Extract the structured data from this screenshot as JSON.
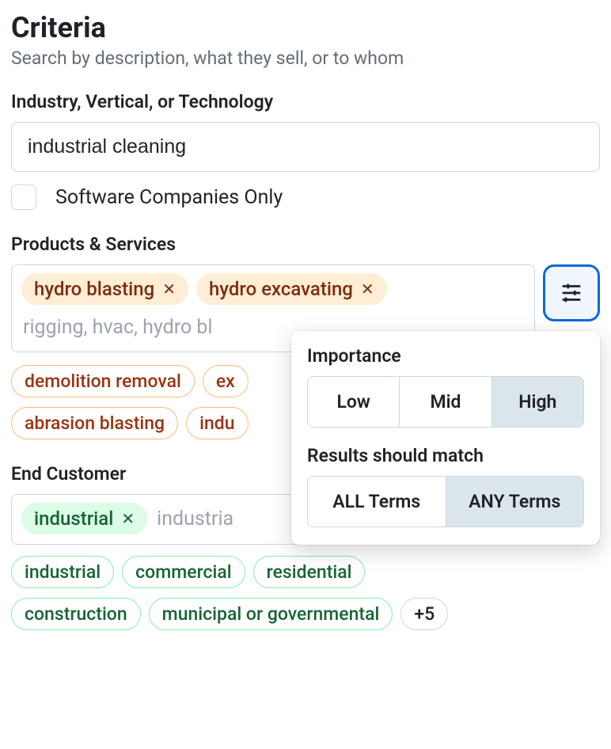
{
  "header": {
    "title": "Criteria",
    "subtitle": "Search by description, what they sell, or to whom"
  },
  "industry": {
    "label": "Industry, Vertical, or Technology",
    "value": "industrial cleaning",
    "checkbox_label": "Software Companies Only"
  },
  "products": {
    "label": "Products & Services",
    "tags": [
      "hydro blasting",
      "hydro excavating"
    ],
    "placeholder": "rigging, hvac, hydro bl",
    "suggestions_row1": [
      "demolition removal",
      "ex"
    ],
    "suggestions_row2": [
      "abrasion blasting",
      "indu"
    ]
  },
  "popover": {
    "importance_label": "Importance",
    "importance_options": [
      "Low",
      "Mid",
      "High"
    ],
    "importance_selected": "High",
    "match_label": "Results should match",
    "match_options": [
      "ALL Terms",
      "ANY Terms"
    ],
    "match_selected": "ANY Terms"
  },
  "endcustomer": {
    "label": "End Customer",
    "tags": [
      "industrial"
    ],
    "inline_text": "industria",
    "suggestions_row1": [
      "industrial",
      "commercial",
      "residential"
    ],
    "suggestions_row2": [
      "construction",
      "municipal or governmental"
    ],
    "more": "+5"
  }
}
